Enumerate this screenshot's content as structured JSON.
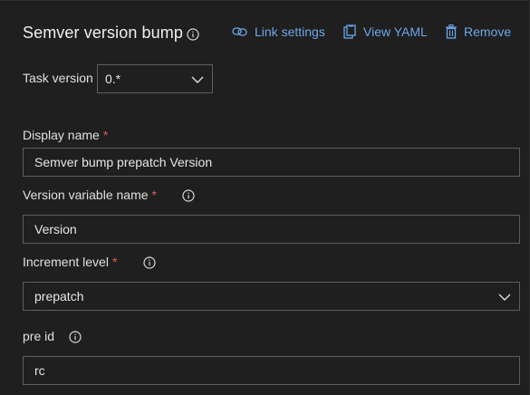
{
  "header": {
    "title": "Semver version bump",
    "actions": {
      "link_settings": "Link settings",
      "view_yaml": "View YAML",
      "remove": "Remove"
    }
  },
  "task_version": {
    "label": "Task version",
    "value": "0.*"
  },
  "fields": {
    "display_name": {
      "label": "Display name",
      "required_mark": "*",
      "value": "Semver bump prepatch Version"
    },
    "version_variable_name": {
      "label": "Version variable name",
      "required_mark": "*",
      "value": "Version"
    },
    "increment_level": {
      "label": "Increment level",
      "required_mark": "*",
      "value": "prepatch"
    },
    "pre_id": {
      "label": "pre id",
      "value": "rc"
    }
  },
  "colors": {
    "background": "#1f1f1f",
    "link": "#6ca6e8",
    "required": "#e05a5a",
    "border": "#5e5e5e"
  },
  "icons": {
    "title_info": "info-icon",
    "link_settings": "link-icon",
    "view_yaml": "clipboard-icon",
    "remove": "trash-icon"
  }
}
